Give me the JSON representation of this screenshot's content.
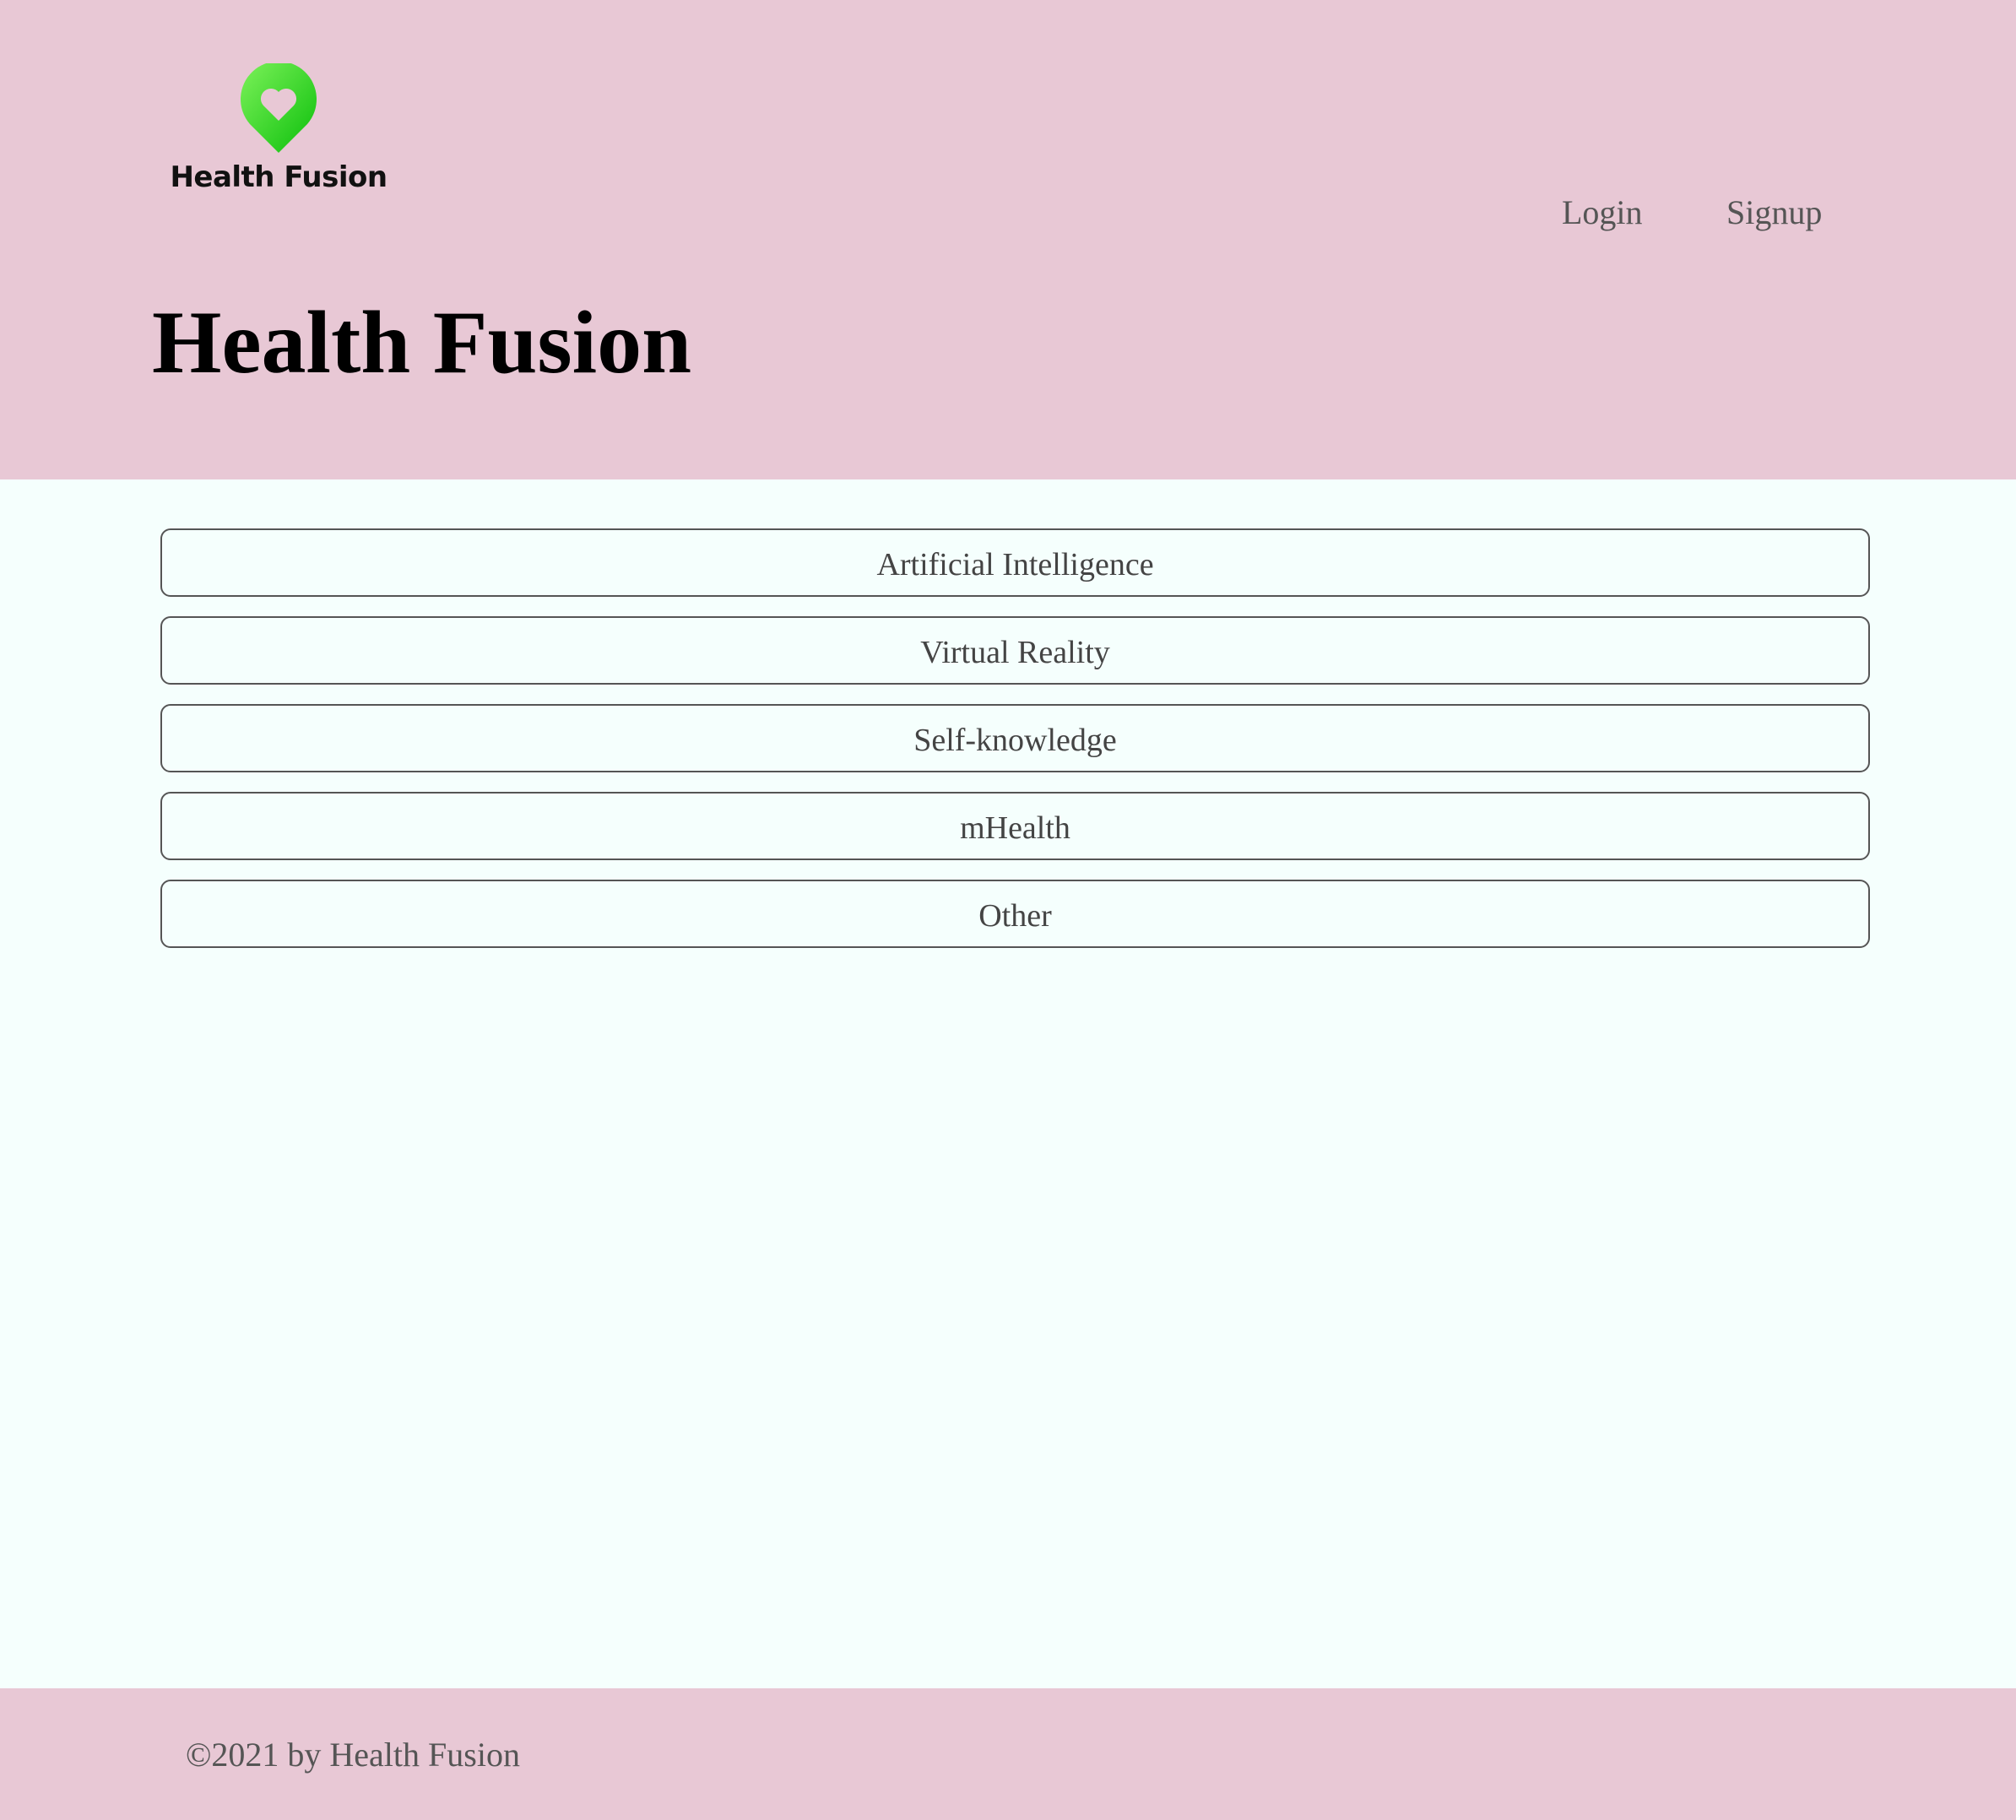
{
  "header": {
    "logo_text": "Health Fusion",
    "nav": {
      "login": "Login",
      "signup": "Signup"
    },
    "title": "Health Fusion"
  },
  "categories": [
    {
      "label": "Artificial Intelligence"
    },
    {
      "label": "Virtual Reality"
    },
    {
      "label": "Self-knowledge"
    },
    {
      "label": "mHealth"
    },
    {
      "label": "Other"
    }
  ],
  "footer": {
    "copyright": "©2021 by Health Fusion"
  },
  "colors": {
    "header_bg": "#e8c8d5",
    "page_bg": "#f5fffd",
    "logo_green": "#22cc22"
  }
}
